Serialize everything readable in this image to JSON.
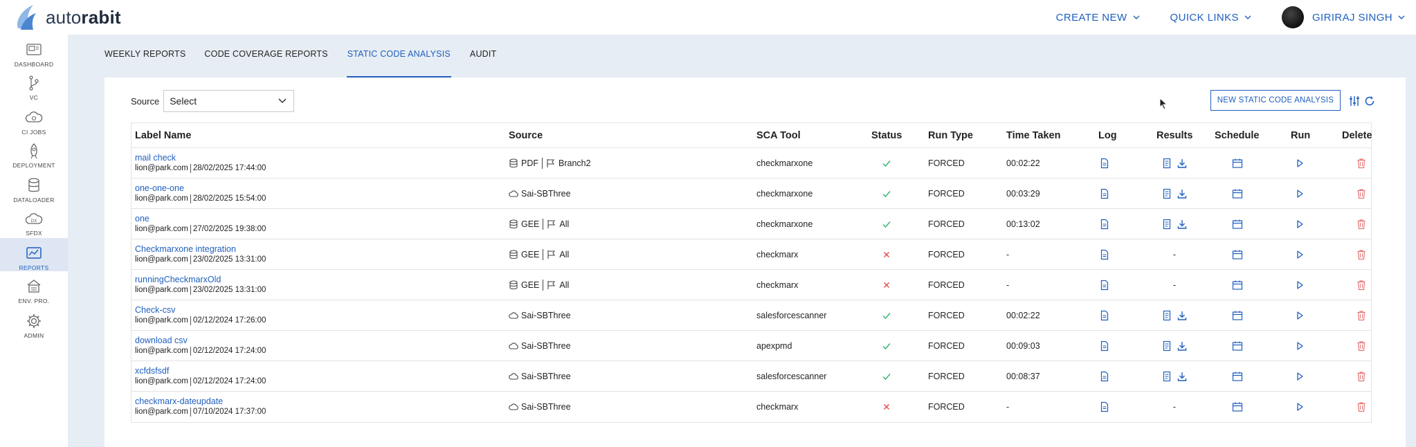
{
  "app": {
    "logo_light": "auto",
    "logo_bold": "rabit"
  },
  "header": {
    "create_new": "CREATE NEW",
    "quick_links": "QUICK LINKS",
    "user": "GIRIRAJ SINGH"
  },
  "sidebar": {
    "items": [
      {
        "label": "DASHBOARD",
        "icon": "dashboard-icon",
        "active": false
      },
      {
        "label": "VC",
        "icon": "version-control-icon",
        "active": false
      },
      {
        "label": "CI JOBS",
        "icon": "ci-jobs-cloud-icon",
        "active": false
      },
      {
        "label": "DEPLOYMENT",
        "icon": "rocket-icon",
        "active": false
      },
      {
        "label": "DATALOADER",
        "icon": "database-icon",
        "active": false
      },
      {
        "label": "SFDX",
        "icon": "sfdx-cloud-icon",
        "active": false
      },
      {
        "label": "REPORTS",
        "icon": "reports-icon",
        "active": true
      },
      {
        "label": "ENV. PRO.",
        "icon": "environment-icon",
        "active": false
      },
      {
        "label": "ADMIN",
        "icon": "gear-icon",
        "active": false
      }
    ]
  },
  "tabs": [
    {
      "label": "WEEKLY REPORTS",
      "active": false
    },
    {
      "label": "CODE COVERAGE REPORTS",
      "active": false
    },
    {
      "label": "STATIC CODE ANALYSIS",
      "active": true
    },
    {
      "label": "AUDIT",
      "active": false
    }
  ],
  "filter": {
    "label": "Source",
    "value": "Select"
  },
  "actions": {
    "new_button": "NEW STATIC CODE ANALYSIS"
  },
  "table": {
    "columns": [
      "Label Name",
      "Source",
      "SCA Tool",
      "Status",
      "Run Type",
      "Time Taken",
      "Log",
      "Results",
      "Schedule",
      "Run",
      "Delete"
    ],
    "rows": [
      {
        "name": "mail check",
        "user": "lion@park.com",
        "date": "28/02/2025 17:44:00",
        "source_type": "db",
        "source": "PDF",
        "branch": "Branch2",
        "tool": "checkmarxone",
        "status": "success",
        "run_type": "FORCED",
        "time": "00:02:22",
        "results": true
      },
      {
        "name": "one-one-one",
        "user": "lion@park.com",
        "date": "28/02/2025 15:54:00",
        "source_type": "cloud",
        "source": "Sai-SBThree",
        "branch": "",
        "tool": "checkmarxone",
        "status": "success",
        "run_type": "FORCED",
        "time": "00:03:29",
        "results": true
      },
      {
        "name": "one",
        "user": "lion@park.com",
        "date": "27/02/2025 19:38:00",
        "source_type": "db",
        "source": "GEE",
        "branch": "All",
        "tool": "checkmarxone",
        "status": "success",
        "run_type": "FORCED",
        "time": "00:13:02",
        "results": true
      },
      {
        "name": "Checkmarxone integration",
        "user": "lion@park.com",
        "date": "23/02/2025 13:31:00",
        "source_type": "db",
        "source": "GEE",
        "branch": "All",
        "tool": "checkmarx",
        "status": "failed",
        "run_type": "FORCED",
        "time": "-",
        "results": false
      },
      {
        "name": "runningCheckmarxOld",
        "user": "lion@park.com",
        "date": "23/02/2025 13:31:00",
        "source_type": "db",
        "source": "GEE",
        "branch": "All",
        "tool": "checkmarx",
        "status": "failed",
        "run_type": "FORCED",
        "time": "-",
        "results": false
      },
      {
        "name": "Check-csv",
        "user": "lion@park.com",
        "date": "02/12/2024 17:26:00",
        "source_type": "cloud",
        "source": "Sai-SBThree",
        "branch": "",
        "tool": "salesforcescanner",
        "status": "success",
        "run_type": "FORCED",
        "time": "00:02:22",
        "results": true
      },
      {
        "name": "download csv",
        "user": "lion@park.com",
        "date": "02/12/2024 17:24:00",
        "source_type": "cloud",
        "source": "Sai-SBThree",
        "branch": "",
        "tool": "apexpmd",
        "status": "success",
        "run_type": "FORCED",
        "time": "00:09:03",
        "results": true
      },
      {
        "name": "xcfdsfsdf",
        "user": "lion@park.com",
        "date": "02/12/2024 17:24:00",
        "source_type": "cloud",
        "source": "Sai-SBThree",
        "branch": "",
        "tool": "salesforcescanner",
        "status": "success",
        "run_type": "FORCED",
        "time": "00:08:37",
        "results": true
      },
      {
        "name": "checkmarx-dateupdate",
        "user": "lion@park.com",
        "date": "07/10/2024 17:37:00",
        "source_type": "cloud",
        "source": "Sai-SBThree",
        "branch": "",
        "tool": "checkmarx",
        "status": "failed",
        "run_type": "FORCED",
        "time": "-",
        "results": false
      }
    ],
    "no_results": "-"
  },
  "colors": {
    "accent": "#1f5fbf",
    "success": "#3cb371",
    "failed": "#e05050",
    "delete": "#e57373"
  }
}
